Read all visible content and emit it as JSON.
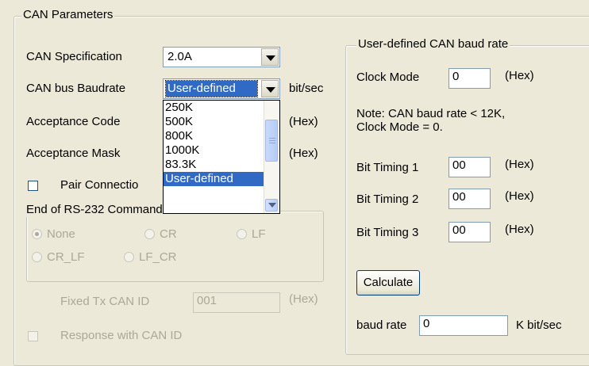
{
  "can_params": {
    "title": "CAN Parameters",
    "spec_label": "CAN Specification",
    "spec_value": "2.0A",
    "baud_label": "CAN bus Baudrate",
    "baud_value": "User-defined",
    "baud_unit": "bit/sec",
    "acceptance_code_label": "Acceptance Code",
    "acceptance_code_unit": "(Hex)",
    "acceptance_mask_label": "Acceptance Mask",
    "acceptance_mask_unit": "(Hex)",
    "pair_connection_label": "Pair Connectio",
    "baud_dropdown_items": [
      "250K",
      "500K",
      "800K",
      "1000K",
      "83.3K",
      "User-defined"
    ],
    "baud_dropdown_selected": "User-defined"
  },
  "rs232": {
    "title": "End of RS-232 Command",
    "options": [
      "None",
      "CR",
      "LF",
      "CR_LF",
      "LF_CR"
    ],
    "selected": "None"
  },
  "fixed_tx": {
    "label": "Fixed Tx CAN ID",
    "value": "001",
    "unit": "(Hex)"
  },
  "response_label": "Response with CAN ID",
  "user_baud": {
    "title": "User-defined CAN baud rate",
    "clock_mode_label": "Clock Mode",
    "clock_mode_value": "0",
    "clock_mode_unit": "(Hex)",
    "note_line1": "Note: CAN baud rate < 12K,",
    "note_line2": "Clock Mode = 0.",
    "bit_timing_1_label": "Bit Timing 1",
    "bit_timing_1_value": "00",
    "bit_timing_2_label": "Bit Timing 2",
    "bit_timing_2_value": "00",
    "bit_timing_3_label": "Bit Timing 3",
    "bit_timing_3_value": "00",
    "hex_unit": "(Hex)",
    "calculate_label": "Calculate",
    "baud_rate_label": "baud rate",
    "baud_rate_value": "0",
    "baud_rate_unit": "K bit/sec"
  },
  "colors": {
    "background": "#ece9d8",
    "selection": "#316ac5",
    "disabled_text": "#aca899"
  }
}
